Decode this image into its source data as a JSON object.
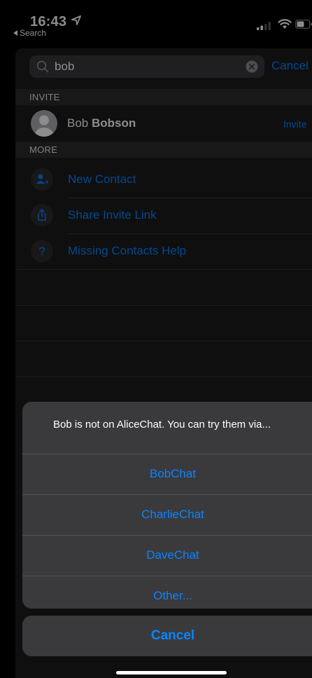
{
  "status_bar": {
    "time": "16:43",
    "back_label": "Search"
  },
  "search": {
    "value": "bob",
    "cancel_label": "Cancel"
  },
  "sections": {
    "invite_header": "INVITE",
    "more_header": "MORE"
  },
  "invite_contact": {
    "first_name": "Bob",
    "last_name": "Bobson",
    "action_label": "Invite"
  },
  "more_actions": [
    {
      "label": "New Contact",
      "icon": "add-contact-icon"
    },
    {
      "label": "Share Invite Link",
      "icon": "share-icon"
    },
    {
      "label": "Missing Contacts Help",
      "icon": "question-mark-icon"
    }
  ],
  "action_sheet": {
    "message": "Bob is not on AliceChat. You can try them via...",
    "options": [
      "BobChat",
      "CharlieChat",
      "DaveChat",
      "Other..."
    ],
    "cancel_label": "Cancel"
  },
  "colors": {
    "accent": "#0a84ff",
    "background": "#1c1c1e",
    "section_header": "#2c2c2e",
    "sheet": "#3a3a3c"
  }
}
